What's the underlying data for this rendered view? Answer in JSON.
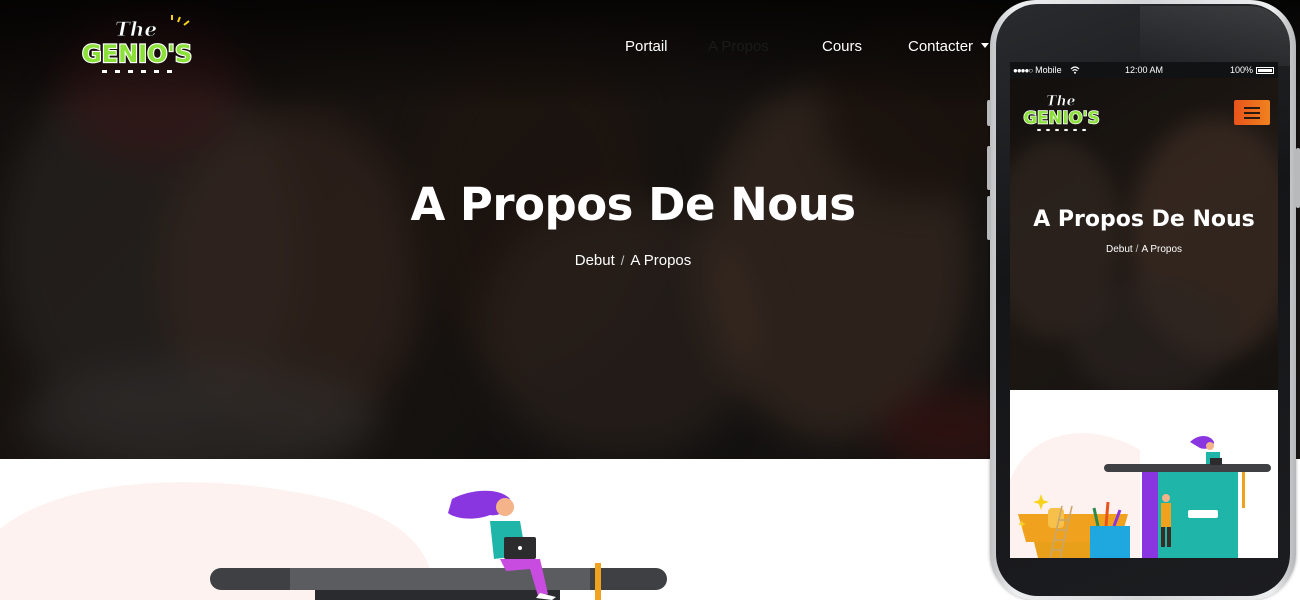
{
  "brand": {
    "logo_line1": "The",
    "logo_line2": "GENIO'S",
    "colors": {
      "accent": "#f0821f",
      "accent_dark": "#e8541b",
      "hero_text": "#ffffff"
    }
  },
  "nav": {
    "items": [
      {
        "label": "Portail"
      },
      {
        "label": "A Propos"
      },
      {
        "label": "Cours"
      },
      {
        "label": "Contacter",
        "icon": "caret-down-icon"
      }
    ]
  },
  "hero": {
    "title": "A Propos De Nous",
    "breadcrumb": {
      "home": "Debut",
      "separator": "/",
      "current": "A Propos"
    }
  },
  "mobile": {
    "statusbar": {
      "carrier": "Mobile",
      "signal_icon": "signal-dots-icon",
      "wifi_icon": "wifi-icon",
      "time": "12:00 AM",
      "battery": "100%"
    },
    "menu_icon": "hamburger-menu-icon",
    "hero": {
      "title": "A Propos De Nous",
      "breadcrumb": {
        "home": "Debut",
        "separator": "/",
        "current": "A Propos"
      }
    }
  }
}
